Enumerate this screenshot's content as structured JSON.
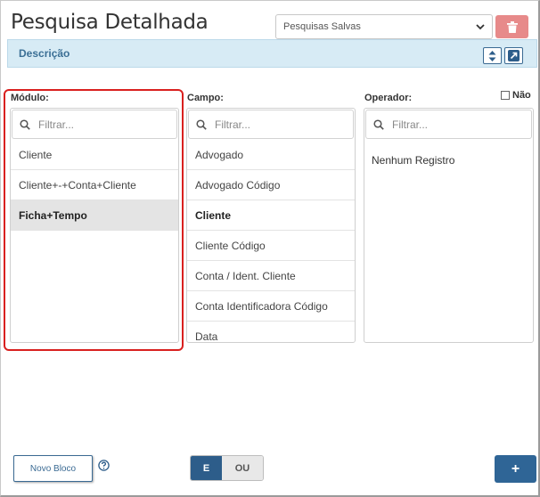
{
  "header": {
    "title": "Pesquisa Detalhada",
    "saved_searches_value": "Pesquisas Salvas"
  },
  "description_bar": {
    "label": "Descrição"
  },
  "columns": {
    "modulo": {
      "label": "Módulo:",
      "filter_placeholder": "Filtrar...",
      "items": [
        "Cliente",
        "Cliente+-+Conta+Cliente",
        "Ficha+Tempo"
      ],
      "selected_index": 2
    },
    "campo": {
      "label": "Campo:",
      "filter_placeholder": "Filtrar...",
      "items": [
        "Advogado",
        "Advogado Código",
        "Cliente",
        "Cliente Código",
        "Conta / Ident. Cliente",
        "Conta Identificadora Código",
        "Data"
      ],
      "bold_index": 2
    },
    "operador": {
      "label": "Operador:",
      "filter_placeholder": "Filtrar...",
      "empty_text": "Nenhum Registro",
      "nao_label": "Não",
      "nao_checked": false
    }
  },
  "footer": {
    "new_block_label": "Novo Bloco",
    "logic_and_label": "E",
    "logic_or_label": "OU",
    "logic_selected": "E",
    "add_label": "+"
  },
  "colors": {
    "accent": "#2f6596",
    "danger": "#e78a8a",
    "description_bg": "#d7ebf5",
    "highlight_outline": "#d9201f"
  },
  "icons": {
    "trash": "trash-icon",
    "sort": "sort-icon",
    "external": "external-link-icon",
    "search": "search-icon",
    "help": "help-circle-icon",
    "chevron": "chevron-down-icon"
  }
}
